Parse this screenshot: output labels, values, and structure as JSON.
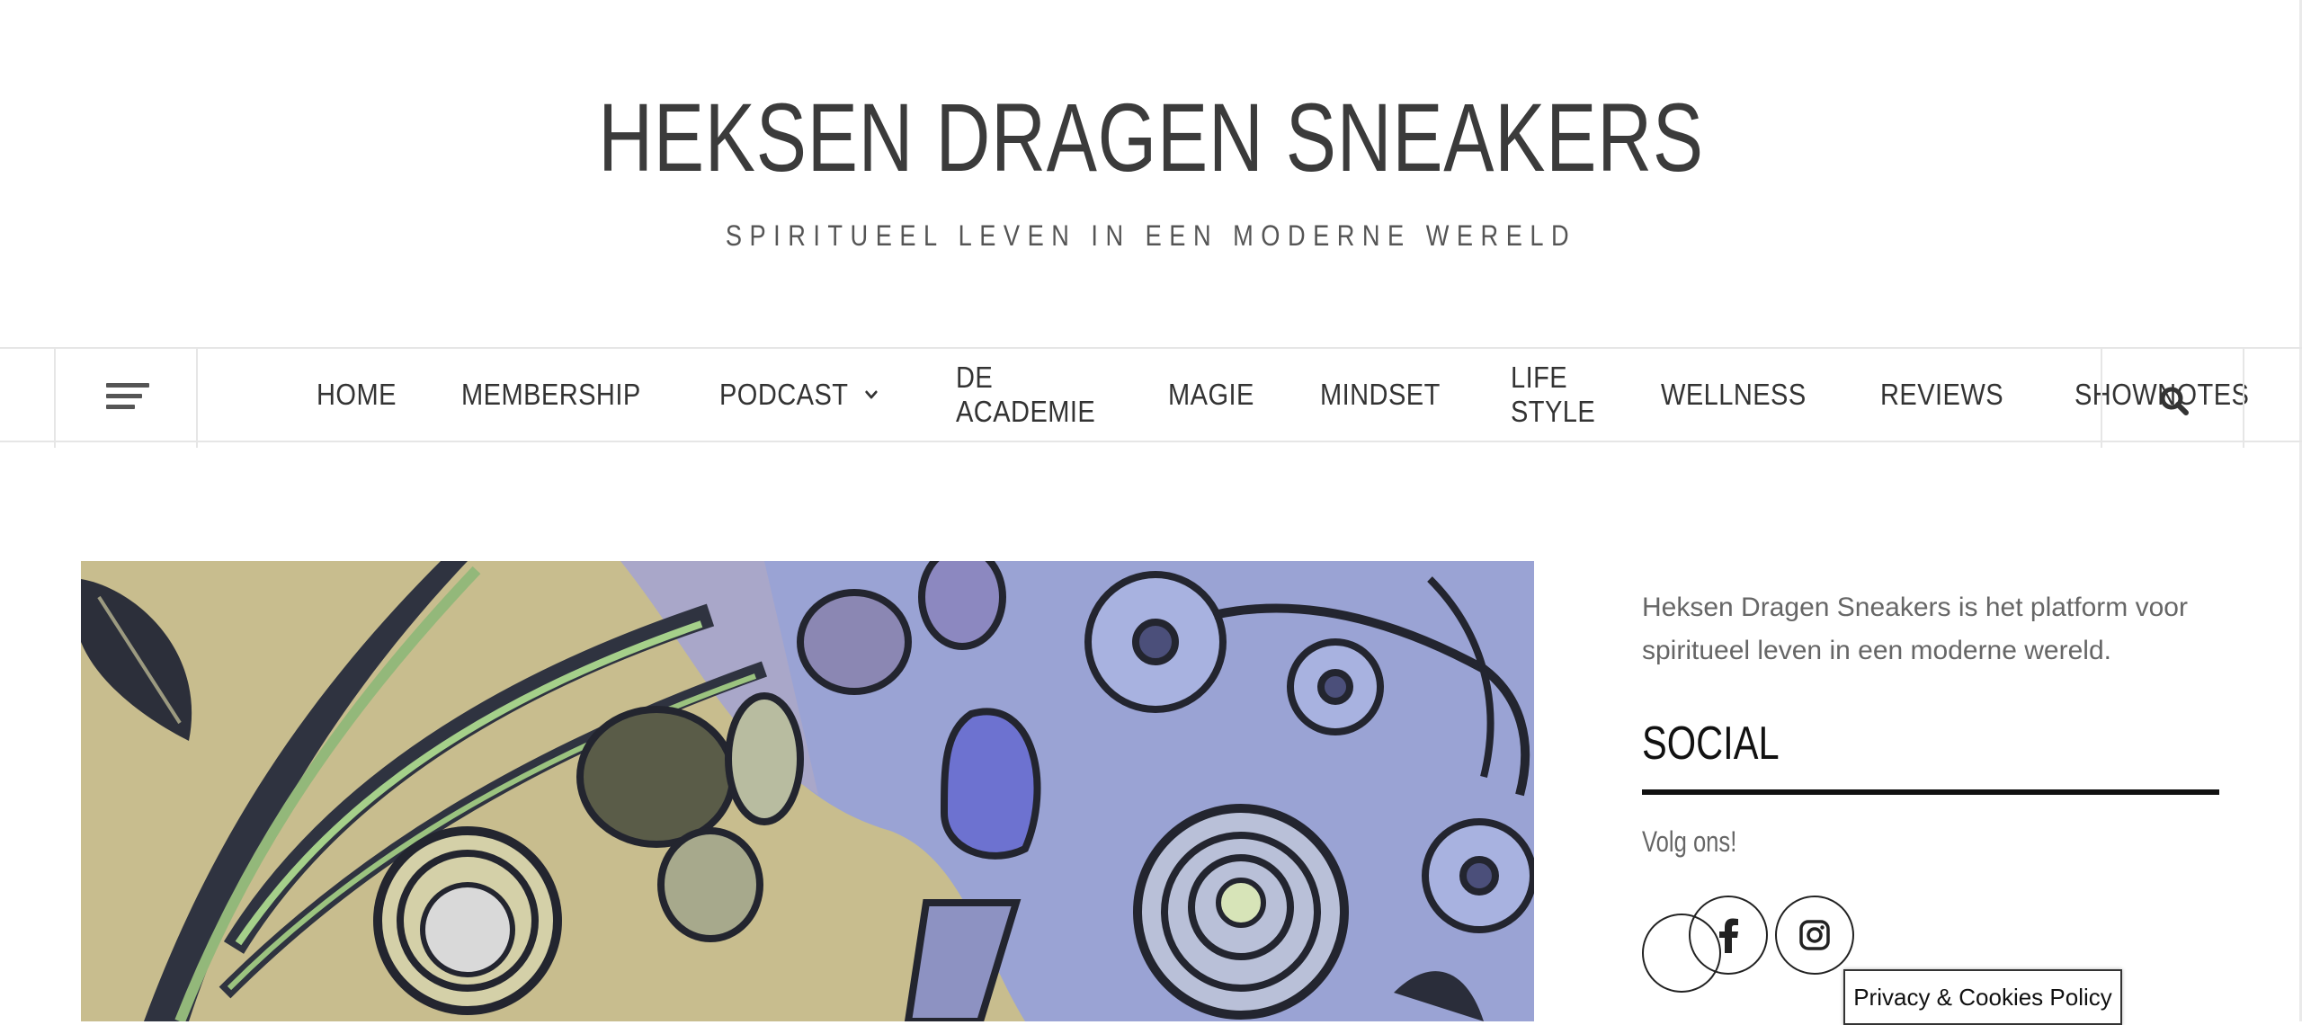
{
  "header": {
    "title": "HEKSEN DRAGEN SNEAKERS",
    "tagline": "SPIRITUEEL LEVEN IN EEN MODERNE WERELD"
  },
  "nav": {
    "items": [
      {
        "label": "HOME"
      },
      {
        "label": "MEMBERSHIP"
      },
      {
        "label": "PODCAST",
        "has_dropdown": true
      },
      {
        "label": "DE ACADEMIE"
      },
      {
        "label": "MAGIE"
      },
      {
        "label": "MINDSET"
      },
      {
        "label": "LIFE STYLE"
      },
      {
        "label": "WELLNESS"
      },
      {
        "label": "REVIEWS"
      },
      {
        "label": "SHOWNOTES"
      }
    ],
    "menu_icon": "hamburger-menu-icon",
    "search_icon": "search-icon"
  },
  "sidebar": {
    "about_text": "Heksen Dragen Sneakers is het platform voor spiritueel leven in een moderne wereld.",
    "social_heading": "SOCIAL",
    "follow_text": "Volg ons!",
    "social_icons": [
      "facebook-icon",
      "instagram-icon"
    ]
  },
  "cookie": {
    "label": "Privacy & Cookies Policy"
  },
  "colors": {
    "text": "#333333",
    "border": "#e6e6e6",
    "hero_khaki": "#c8bd8e",
    "hero_lavender": "#9aa3d4"
  }
}
